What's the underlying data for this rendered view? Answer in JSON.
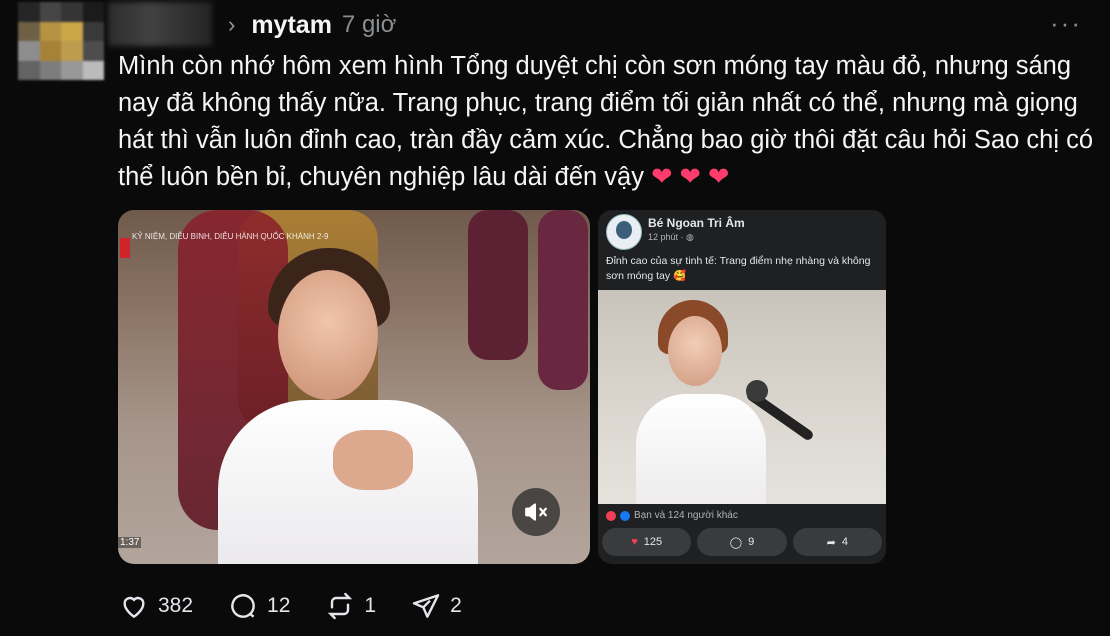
{
  "author": {
    "username": "mytam",
    "time": "7 giờ"
  },
  "post": {
    "text": "Mình còn nhớ hôm xem hình Tổng duyệt chị còn sơn móng tay màu đỏ, nhưng sáng nay đã không thấy nữa. Trang phục, trang điểm tối giản nhất có thể, nhưng mà giọng hát thì vẫn luôn đỉnh cao, tràn đầy cảm xúc. Chẳng bao giờ thôi đặt câu hỏi Sao chị có thể luôn bền bỉ, chuyên nghiệp lâu dài đến vậy",
    "hearts": "❤ ❤ ❤"
  },
  "video": {
    "caption": "KỶ NIỆM, DIỄU BINH, DIỄU HÀNH QUỐC KHÁNH 2-9",
    "timestamp": "1:37"
  },
  "embedded": {
    "name": "Bé Ngoan Tri Âm",
    "meta": "12 phút · ",
    "caption": "Đỉnh cao của sự tinh tế: Trang điểm nhẹ nhàng và không sơn móng tay 🥰",
    "reactions_text": "Bạn và 124 người khác",
    "like_count": "125",
    "comment_count": "9",
    "share_count": "4"
  },
  "actions": {
    "likes": "382",
    "replies": "12",
    "reposts": "1",
    "shares": "2"
  },
  "colors": {
    "background": "#0a0a0a",
    "text": "#f3f5f7",
    "muted": "#8a8d91",
    "heart": "#ff3c6b"
  },
  "icons": [
    "chevron-right-icon",
    "more-icon",
    "mute-icon",
    "heart-icon",
    "comment-icon",
    "repost-icon",
    "share-icon"
  ]
}
